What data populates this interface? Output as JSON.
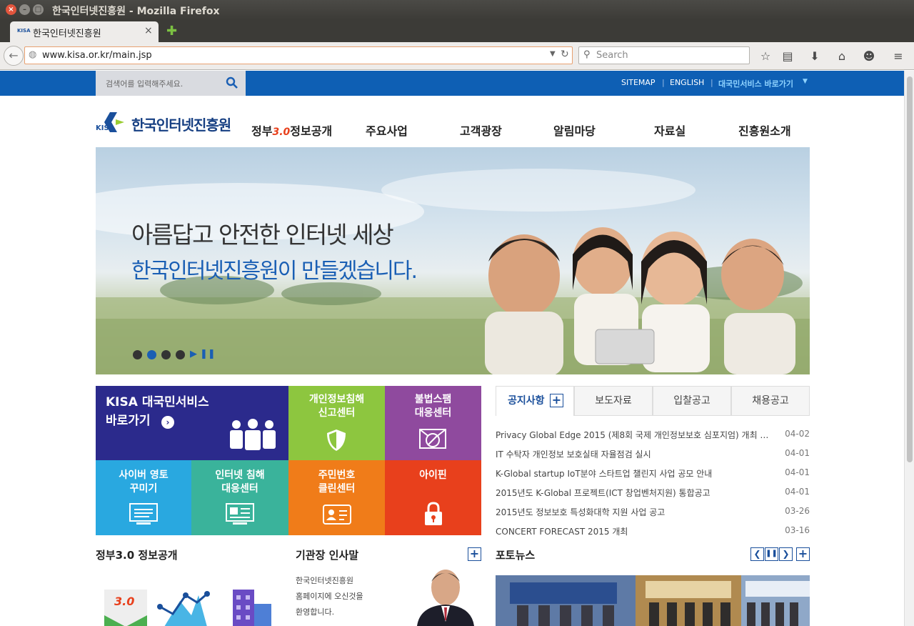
{
  "window": {
    "title": "한국인터넷진흥원 - Mozilla Firefox"
  },
  "tab": {
    "label": "한국인터넷진흥원",
    "favicon": "KISA"
  },
  "navbar": {
    "url": "www.kisa.or.kr/main.jsp",
    "search_placeholder": "Search"
  },
  "site": {
    "search_placeholder": "검색어를 입력해주세요.",
    "utility_links": [
      "SITEMAP",
      "ENGLISH",
      "대국민서비스 바로가기"
    ],
    "logo_abbr": "KISA",
    "logo_name": "한국인터넷진흥원",
    "gnb": {
      "gov_prefix": "정부",
      "gov_num": "3.0",
      "gov_suffix": "정보공개",
      "items": [
        "주요사업",
        "고객광장",
        "알림마당",
        "자료실",
        "진흥원소개"
      ]
    },
    "hero": {
      "line1": "아름답고 안전한 인터넷 세상",
      "line2": "한국인터넷진흥원이 만들겠습니다.",
      "slide_count": 4,
      "active_slide": 2
    },
    "service": {
      "main_line1": "KISA 대국민서비스",
      "main_line2": "바로가기",
      "tiles": [
        {
          "l1": "개인정보침해",
          "l2": "신고센터",
          "color": "#8dc63f"
        },
        {
          "l1": "불법스팸",
          "l2": "대응센터",
          "color": "#8f4a9e"
        },
        {
          "l1": "사이버 영토",
          "l2": "꾸미기",
          "color": "#29a8e0"
        },
        {
          "l1": "인터넷 침해",
          "l2": "대응센터",
          "color": "#3ab39b"
        },
        {
          "l1": "주민번호",
          "l2": "클린센터",
          "color": "#f07c19"
        },
        {
          "l1": "아이핀",
          "l2": "",
          "color": "#e8401c"
        }
      ],
      "main_color": "#2b2a8c"
    },
    "news": {
      "tabs": [
        "공지사항",
        "보도자료",
        "입찰공고",
        "채용공고"
      ],
      "items": [
        {
          "title": "Privacy Global Edge 2015 (제8회 국제 개인정보보호 심포지엄) 개최 …",
          "date": "04-02"
        },
        {
          "title": "IT 수탁자 개인정보 보호실태 자율점검 실시",
          "date": "04-01"
        },
        {
          "title": "K-Global startup IoT분야 스타트업 챌린지 사업 공모 안내",
          "date": "04-01"
        },
        {
          "title": "2015년도 K-Global 프로젝트(ICT 창업벤처지원) 통합공고",
          "date": "04-01"
        },
        {
          "title": "2015년도 정보보호 특성화대학 지원 사업 공고",
          "date": "03-26"
        },
        {
          "title": "CONCERT FORECAST 2015 개최",
          "date": "03-16"
        }
      ]
    },
    "bottom": {
      "gov_title": "정부3.0 정보공개",
      "ceo_title": "기관장 인사말",
      "ceo_text": [
        "한국인터넷진흥원",
        "홈페이지에 오신것을",
        "환영합니다."
      ],
      "photo_title": "포토뉴스",
      "gov_icon_text": "3.0"
    }
  }
}
